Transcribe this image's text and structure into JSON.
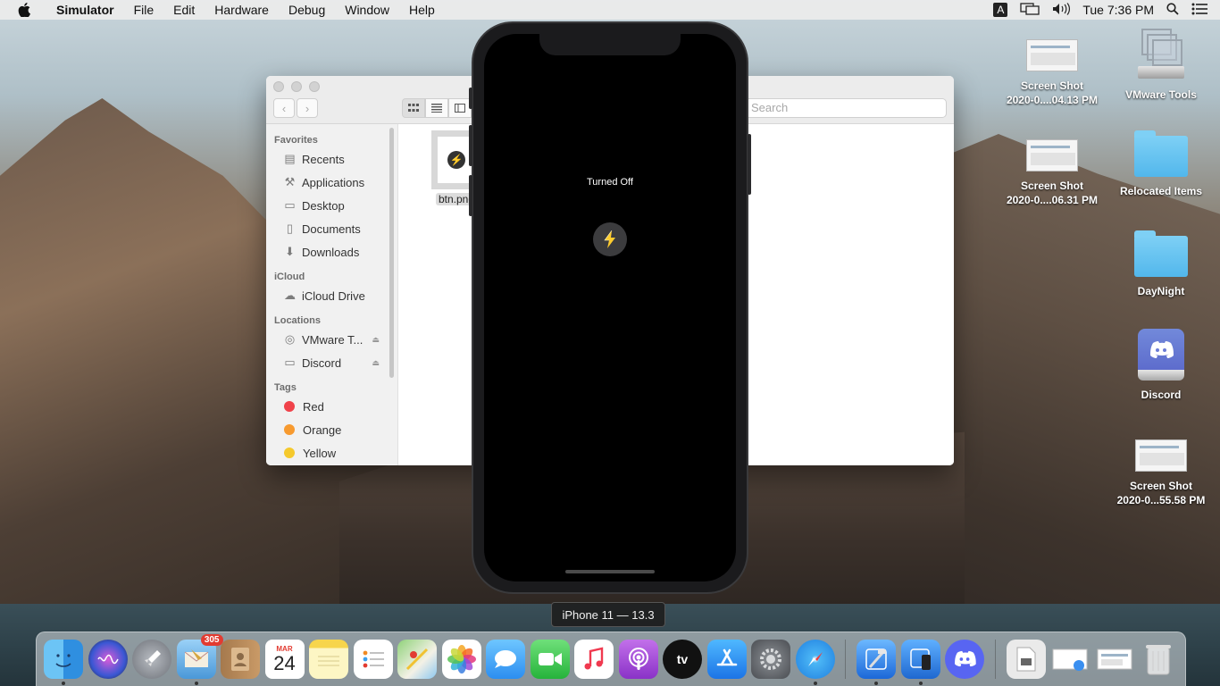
{
  "menubar": {
    "app_name": "Simulator",
    "menus": [
      "File",
      "Edit",
      "Hardware",
      "Debug",
      "Window",
      "Help"
    ],
    "input_badge": "A",
    "clock": "Tue 7:36 PM"
  },
  "finder": {
    "search_placeholder": "Search",
    "sidebar": {
      "favorites_heading": "Favorites",
      "favorites": [
        "Recents",
        "Applications",
        "Desktop",
        "Documents",
        "Downloads"
      ],
      "icloud_heading": "iCloud",
      "icloud": [
        "iCloud Drive"
      ],
      "locations_heading": "Locations",
      "locations": [
        "VMware T...",
        "Discord"
      ],
      "tags_heading": "Tags",
      "tags": [
        {
          "name": "Red",
          "color": "#f0424a"
        },
        {
          "name": "Orange",
          "color": "#f79a2f"
        },
        {
          "name": "Yellow",
          "color": "#f5c92c"
        }
      ]
    },
    "file_label": "btn.png"
  },
  "simulator": {
    "status_text": "Turned Off",
    "device_label": "iPhone 11 — 13.3"
  },
  "desktop_icons": [
    {
      "line1": "Screen Shot",
      "line2": "2020-0....04.13 PM"
    },
    {
      "line1": "VMware Tools",
      "line2": ""
    },
    {
      "line1": "Screen Shot",
      "line2": "2020-0....06.31 PM"
    },
    {
      "line1": "Relocated Items",
      "line2": ""
    },
    {
      "line1": "DayNight",
      "line2": ""
    },
    {
      "line1": "Discord",
      "line2": ""
    },
    {
      "line1": "Screen Shot",
      "line2": "2020-0...55.58 PM"
    }
  ],
  "dock": {
    "mail_badge": "305",
    "calendar_month": "MAR",
    "calendar_day": "24",
    "tv_label": "tv"
  }
}
